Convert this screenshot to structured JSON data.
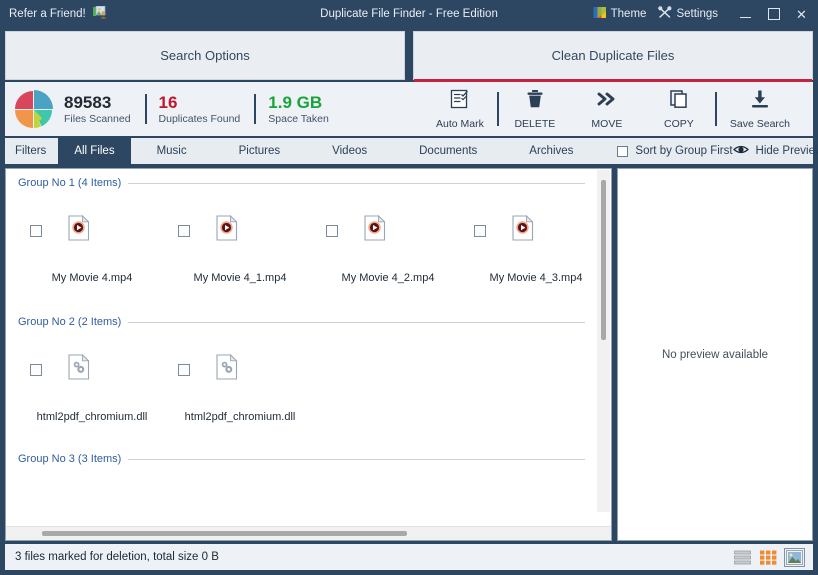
{
  "window": {
    "title": "Duplicate File Finder - Free Edition",
    "refer_label": "Refer a Friend!",
    "refer_icon": "gift-people-icon",
    "theme_label": "Theme",
    "theme_icon": "palette-icon",
    "settings_label": "Settings",
    "settings_icon": "tools-icon",
    "minimize_icon": "minimize-icon",
    "maximize_icon": "maximize-icon",
    "close_icon": "close-icon",
    "close_glyph": "✕"
  },
  "tabs": [
    {
      "label": "Search Options",
      "active": false
    },
    {
      "label": "Clean Duplicate Files",
      "active": true
    }
  ],
  "stats": {
    "pie_icon": "pie-chart-icon",
    "items": [
      {
        "value": "89583",
        "label": "Files Scanned",
        "color": "#222b35"
      },
      {
        "value": "16",
        "label": "Duplicates Found",
        "color": "#c0172c"
      },
      {
        "value": "1.9 GB",
        "label": "Space Taken",
        "color": "#17a53a"
      }
    ]
  },
  "toolbar": {
    "auto_mark_label": "Auto Mark",
    "auto_mark_icon": "checklist-icon",
    "delete_label": "DELETE",
    "delete_icon": "trash-icon",
    "move_label": "MOVE",
    "move_icon": "double-chevron-right-icon",
    "copy_label": "COPY",
    "copy_icon": "copy-icon",
    "save_search_label": "Save Search",
    "save_search_icon": "download-icon"
  },
  "filters": {
    "label": "Filters",
    "chips": [
      {
        "label": "All Files",
        "active": true
      },
      {
        "label": "Music",
        "active": false
      },
      {
        "label": "Pictures",
        "active": false
      },
      {
        "label": "Videos",
        "active": false
      },
      {
        "label": "Documents",
        "active": false
      },
      {
        "label": "Archives",
        "active": false
      }
    ],
    "sort_label": "Sort by Group First",
    "sort_checked": false,
    "hide_preview_label": "Hide Preview",
    "eye_icon": "eye-icon"
  },
  "groups": [
    {
      "title": "Group No 1 (4 Items)",
      "items": [
        {
          "name": "My Movie 4.mp4",
          "icon": "video-file-icon",
          "checked": false
        },
        {
          "name": "My Movie 4_1.mp4",
          "icon": "video-file-icon",
          "checked": false
        },
        {
          "name": "My Movie 4_2.mp4",
          "icon": "video-file-icon",
          "checked": false
        },
        {
          "name": "My Movie 4_3.mp4",
          "icon": "video-file-icon",
          "checked": false
        }
      ]
    },
    {
      "title": "Group No 2 (2 Items)",
      "items": [
        {
          "name": "html2pdf_chromium.dll",
          "icon": "dll-file-icon",
          "checked": false
        },
        {
          "name": "html2pdf_chromium.dll",
          "icon": "dll-file-icon",
          "checked": false
        }
      ]
    },
    {
      "title": "Group No 3 (3 Items)",
      "items": []
    }
  ],
  "preview": {
    "message": "No preview available"
  },
  "status": {
    "text": "3 files marked for deletion, total size 0 B",
    "view_modes": [
      {
        "icon": "list-view-icon",
        "selected": false
      },
      {
        "icon": "grid-view-icon",
        "selected": false
      },
      {
        "icon": "thumbnail-view-icon",
        "selected": true
      }
    ]
  },
  "colors": {
    "chrome": "#2d4662",
    "accent_red": "#c2243f",
    "panel": "#eef1f5",
    "link_blue": "#2f5d9e"
  }
}
